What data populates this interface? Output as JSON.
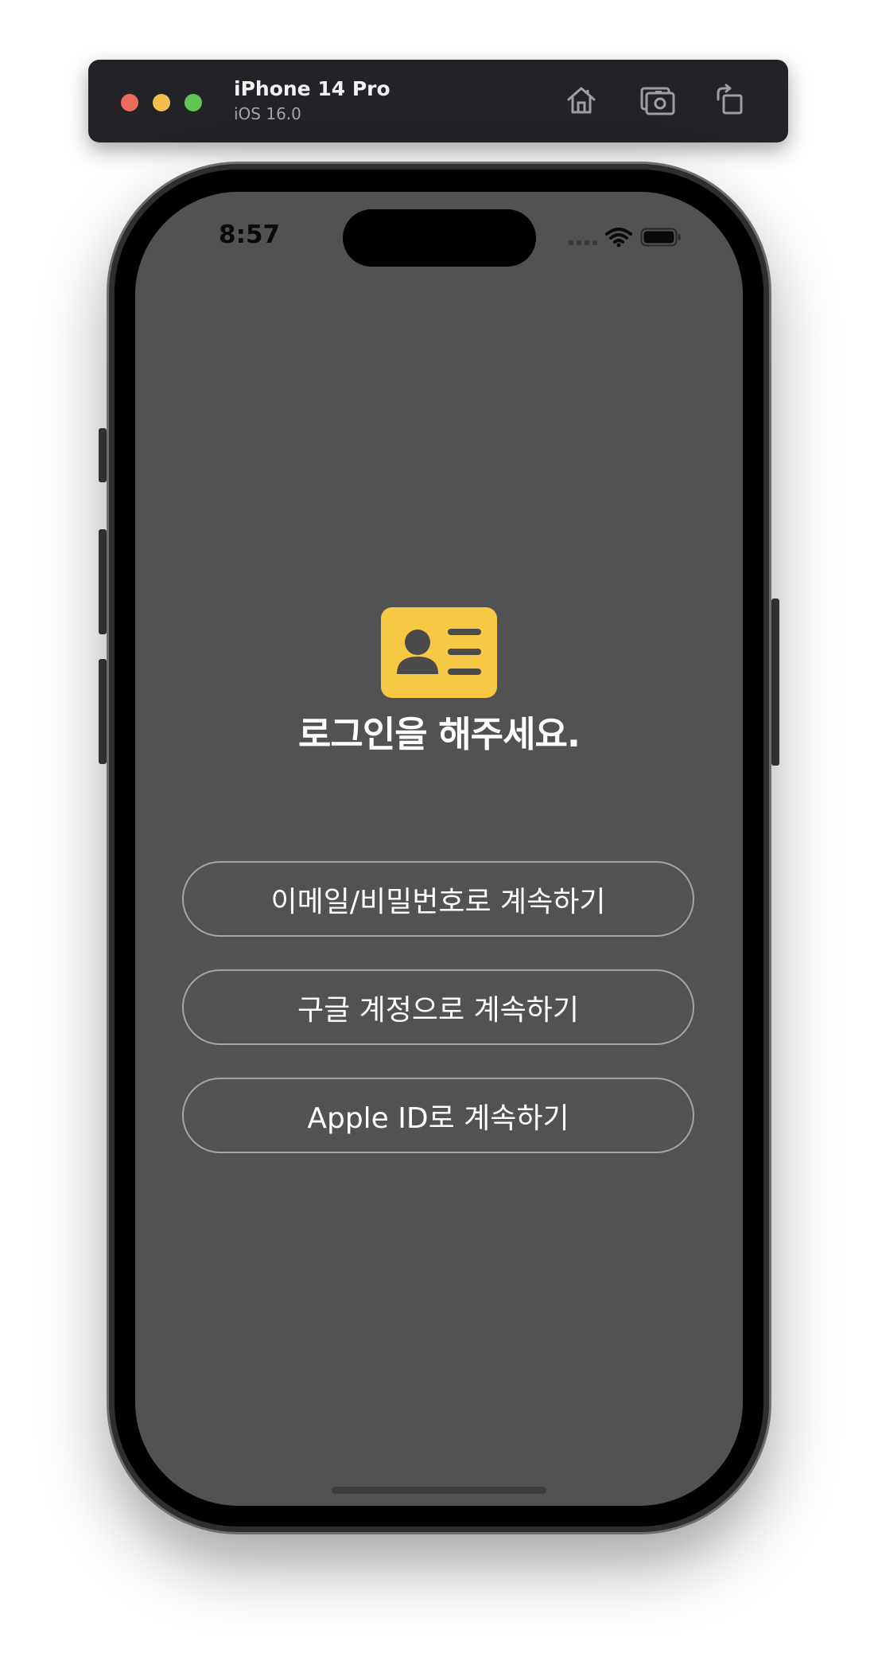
{
  "simulator": {
    "device_name": "iPhone 14 Pro",
    "os_version": "iOS 16.0",
    "toolbar_icons": [
      "home-icon",
      "screenshot-icon",
      "rotate-icon"
    ]
  },
  "status_bar": {
    "time": "8:57",
    "icons": [
      "cellular-signal-icon",
      "wifi-icon",
      "battery-icon"
    ]
  },
  "login": {
    "icon": "contact-card-icon",
    "title": "로그인을 해주세요.",
    "buttons": {
      "email": "이메일/비밀번호로 계속하기",
      "google": "구글 계정으로 계속하기",
      "apple": "Apple ID로 계속하기"
    }
  },
  "colors": {
    "screen_background": "#525252",
    "accent_icon": "#f7c843",
    "button_border": "#a4a4a4",
    "text": "#ffffff"
  }
}
